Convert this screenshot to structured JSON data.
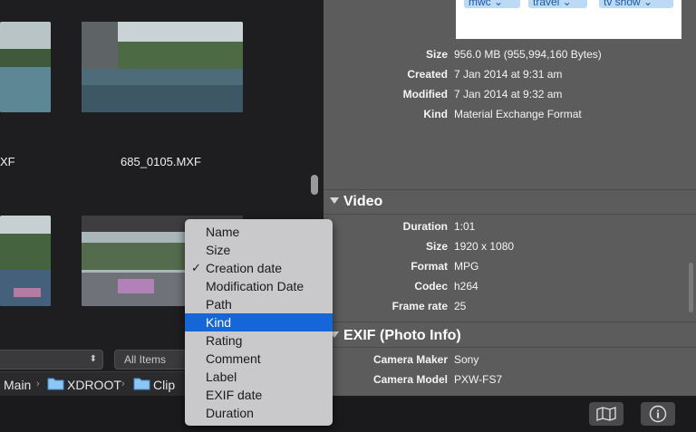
{
  "browser": {
    "file_label_left": "XF",
    "file_label_right": "685_0105.MXF",
    "filter_popup": "",
    "search_popup": "All Items",
    "breadcrumbs": [
      "Main",
      "XDROOT",
      "Clip"
    ]
  },
  "tags": [
    "mwc",
    "travel",
    "tv show"
  ],
  "info": {
    "rows": [
      {
        "label": "Size",
        "value": "956.0 MB (955,994,160 Bytes)"
      },
      {
        "label": "Created",
        "value": "7 Jan 2014 at 9:31 am"
      },
      {
        "label": "Modified",
        "value": "7 Jan 2014 at 9:32 am"
      },
      {
        "label": "Kind",
        "value": "Material Exchange Format"
      }
    ]
  },
  "video": {
    "title": "Video",
    "rows": [
      {
        "label": "Duration",
        "value": "1:01"
      },
      {
        "label": "Size",
        "value": "1920 x 1080"
      },
      {
        "label": "Format",
        "value": "MPG"
      },
      {
        "label": "Codec",
        "value": "h264"
      },
      {
        "label": "Frame rate",
        "value": "25"
      }
    ]
  },
  "exif": {
    "title": "EXIF (Photo Info)",
    "rows": [
      {
        "label": "Camera Maker",
        "value": "Sony"
      },
      {
        "label": "Camera Model",
        "value": "PXW-FS7"
      }
    ]
  },
  "sort_menu": {
    "items": [
      "Name",
      "Size",
      "Creation date",
      "Modification Date",
      "Path",
      "Kind",
      "Rating",
      "Comment",
      "Label",
      "EXIF date",
      "Duration"
    ],
    "checked": "Creation date",
    "highlighted": "Kind",
    "check_glyph": "✓"
  },
  "toolbar": {
    "map_icon": "map-icon",
    "info_icon": "info-icon",
    "info_glyph": "i"
  },
  "colors": {
    "menu_highlight": "#1566d8",
    "tag_bg": "#bcdaf5",
    "tag_text": "#1a56a8"
  }
}
